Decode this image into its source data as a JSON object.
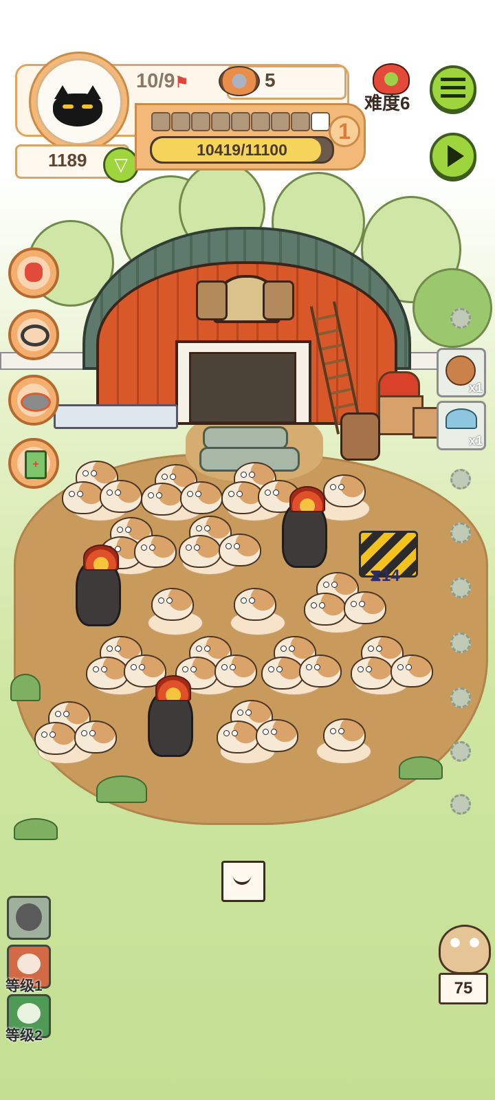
{
  "player": {
    "cat_count": "10/9",
    "coins": "1189",
    "food_count": "5",
    "difficulty_label": "难度6",
    "level_badge": "1",
    "xp_text": "10419/11100",
    "xp_fraction": 0.939,
    "progress_segments_filled": 8,
    "progress_segments_total": 9
  },
  "board": {
    "barrier_timer": "14"
  },
  "items": [
    {
      "name": "peanut",
      "count": "x1"
    },
    {
      "name": "mushroom",
      "count": "x1"
    }
  ],
  "bottom": {
    "level1_label": "等级1",
    "level2_label": "等级2",
    "hamster_counter": "75"
  },
  "icons": {
    "menu": "list-icon",
    "play": "play-icon",
    "flag": "flag-icon",
    "food": "food-bowl-icon",
    "shield": "shield-down-icon",
    "hourglass": "hourglass-icon"
  },
  "colors": {
    "accent_green": "#9ed43c",
    "panel_orange": "#f2b978",
    "xp_yellow": "#f6d35a",
    "badge_orange": "#e07a3a"
  }
}
